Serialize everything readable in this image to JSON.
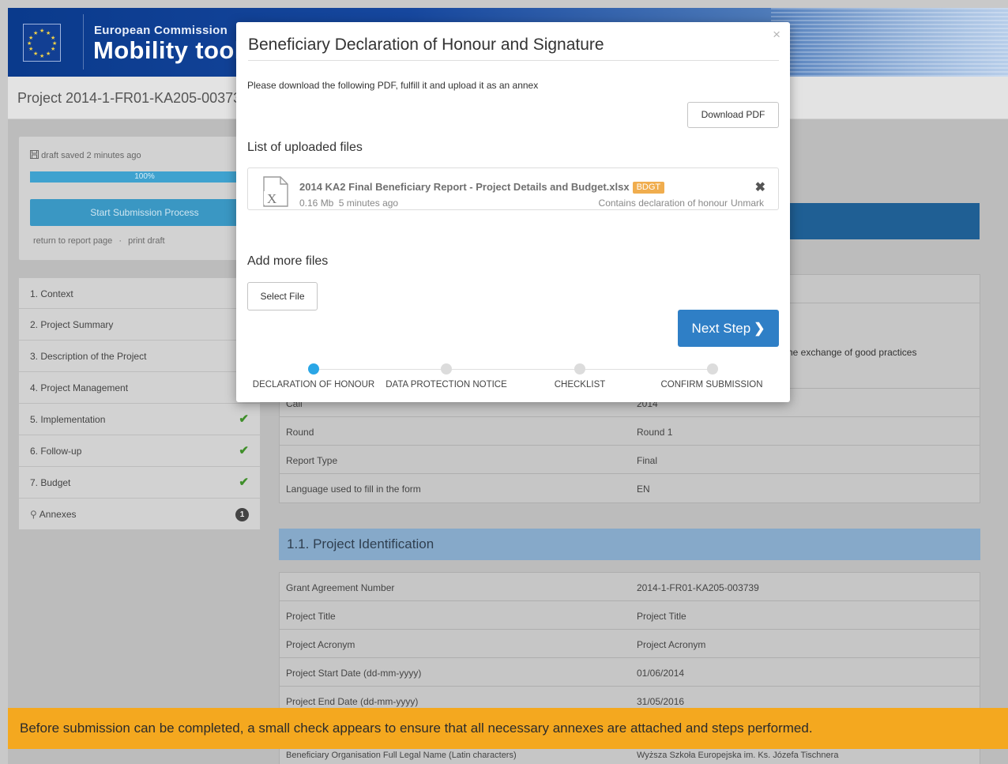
{
  "header": {
    "org": "European Commission",
    "app": "Mobility tool"
  },
  "page": {
    "project_title": "Project 2014-1-FR01-KA205-003739"
  },
  "status": {
    "draft_saved": "draft saved 2 minutes ago",
    "progress": "100%",
    "progress_value": 100,
    "submit_button": "Start Submission Process",
    "return_link": "return to report page",
    "separator": "·",
    "print_link": "print draft"
  },
  "sidebar": {
    "items": [
      {
        "label": "1. Context",
        "done": true
      },
      {
        "label": "2. Project Summary",
        "done": true
      },
      {
        "label": "3. Description of the Project",
        "done": true
      },
      {
        "label": "4. Project Management",
        "done": true
      },
      {
        "label": "5. Implementation",
        "done": true
      },
      {
        "label": "6. Follow-up",
        "done": true
      },
      {
        "label": "7. Budget",
        "done": true
      },
      {
        "label": "Annexes",
        "badge": "1"
      }
    ]
  },
  "context_table": {
    "partial_text": "he exchange of good practices",
    "rows": [
      {
        "label": "Call",
        "value": "2014"
      },
      {
        "label": "Round",
        "value": "Round  1"
      },
      {
        "label": "Report Type",
        "value": "Final"
      },
      {
        "label": "Language used to fill in the form",
        "value": "EN"
      }
    ]
  },
  "identification": {
    "heading": "1.1. Project Identification",
    "rows": [
      {
        "label": "Grant Agreement Number",
        "value": "2014-1-FR01-KA205-003739"
      },
      {
        "label": "Project Title",
        "value": "Project Title"
      },
      {
        "label": "Project Acronym",
        "value": "Project Acronym"
      },
      {
        "label": "Project Start Date (dd-mm-yyyy)",
        "value": "01/06/2014"
      },
      {
        "label": "Project End Date (dd-mm-yyyy)",
        "value": "31/05/2016"
      }
    ],
    "extra_row": {
      "label": "Beneficiary Organisation Full Legal Name (Latin characters)",
      "value": "Wyższa Szkoła Europejska im. Ks. Józefa Tischnera"
    }
  },
  "notice": "Before submission can be completed, a small check appears to ensure that all necessary annexes are attached and steps performed.",
  "modal": {
    "title": "Beneficiary Declaration of Honour and Signature",
    "close": "×",
    "instruction": "Please download the following PDF, fulfill it and upload it as an annex",
    "download_button": "Download PDF",
    "uploaded_heading": "List of uploaded files",
    "file": {
      "name": "2014 KA2 Final Beneficiary Report - Project Details and Budget.xlsx",
      "tag": "BDGT",
      "size": "0.16 Mb",
      "time": "5 minutes ago",
      "declaration": "Contains declaration of honour",
      "unmark": "Unmark"
    },
    "add_heading": "Add more files",
    "select_button": "Select File",
    "next_button": "Next Step",
    "steps": [
      {
        "label": "DECLARATION OF HONOUR",
        "active": true
      },
      {
        "label": "DATA PROTECTION NOTICE",
        "active": false
      },
      {
        "label": "CHECKLIST",
        "active": false
      },
      {
        "label": "CONFIRM SUBMISSION",
        "active": false
      }
    ]
  },
  "colors": {
    "header_blue": "#0a3a8c",
    "accent_blue": "#2f7fc6",
    "notice_orange": "#f4a81f",
    "check_green": "#3f8f2a",
    "step_active": "#2aa6e6",
    "tag_orange": "#f0ad4e"
  }
}
